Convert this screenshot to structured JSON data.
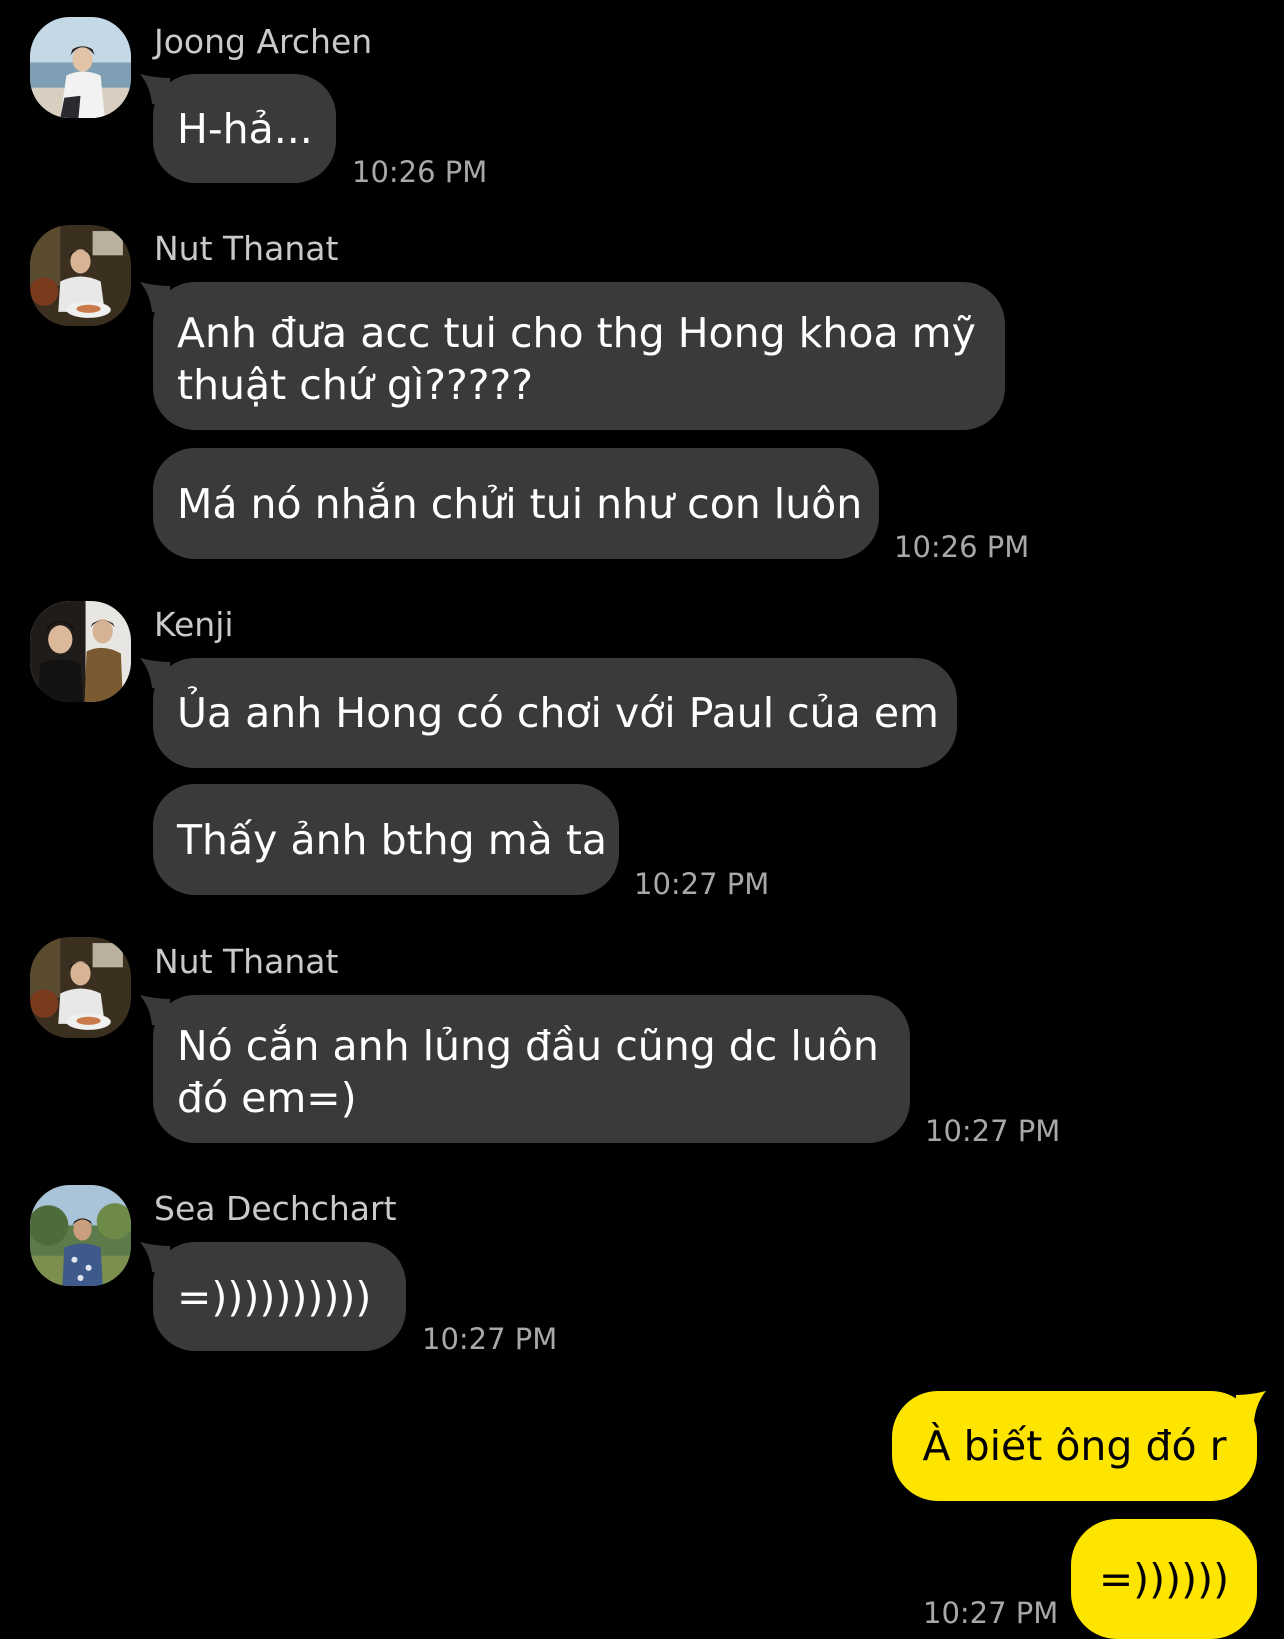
{
  "colors": {
    "background": "#000000",
    "incoming_bubble": "#3a3a3c",
    "outgoing_bubble": "#fee500",
    "sender_name": "#c9c9c9",
    "timestamp": "#a8a8a8"
  },
  "messages": [
    {
      "sender": "Joong Archen",
      "avatar": "joong-archen-avatar",
      "bubbles": [
        "H-hả..."
      ],
      "time": "10:26 PM"
    },
    {
      "sender": "Nut Thanat",
      "avatar": "nut-thanat-avatar",
      "bubbles": [
        [
          "Anh đưa acc tui cho thg Hong khoa mỹ",
          "thuật chứ gì?????"
        ],
        "Má nó nhắn chửi tui như con luôn"
      ],
      "time": "10:26 PM"
    },
    {
      "sender": "Kenji",
      "avatar": "kenji-avatar",
      "bubbles": [
        "Ủa anh Hong có chơi với Paul của em",
        "Thấy ảnh bthg mà ta"
      ],
      "time": "10:27 PM"
    },
    {
      "sender": "Nut Thanat",
      "avatar": "nut-thanat-avatar",
      "bubbles": [
        [
          "Nó cắn anh lủng đầu cũng dc luôn",
          "đó em=)"
        ]
      ],
      "time": "10:27 PM"
    },
    {
      "sender": "Sea Dechchart",
      "avatar": "sea-dechchart-avatar",
      "bubbles": [
        "=))))))))))"
      ],
      "time": "10:27 PM"
    }
  ],
  "outgoing": {
    "bubbles": [
      "À biết ông đó r",
      "=))))))"
    ],
    "time": "10:27 PM"
  }
}
